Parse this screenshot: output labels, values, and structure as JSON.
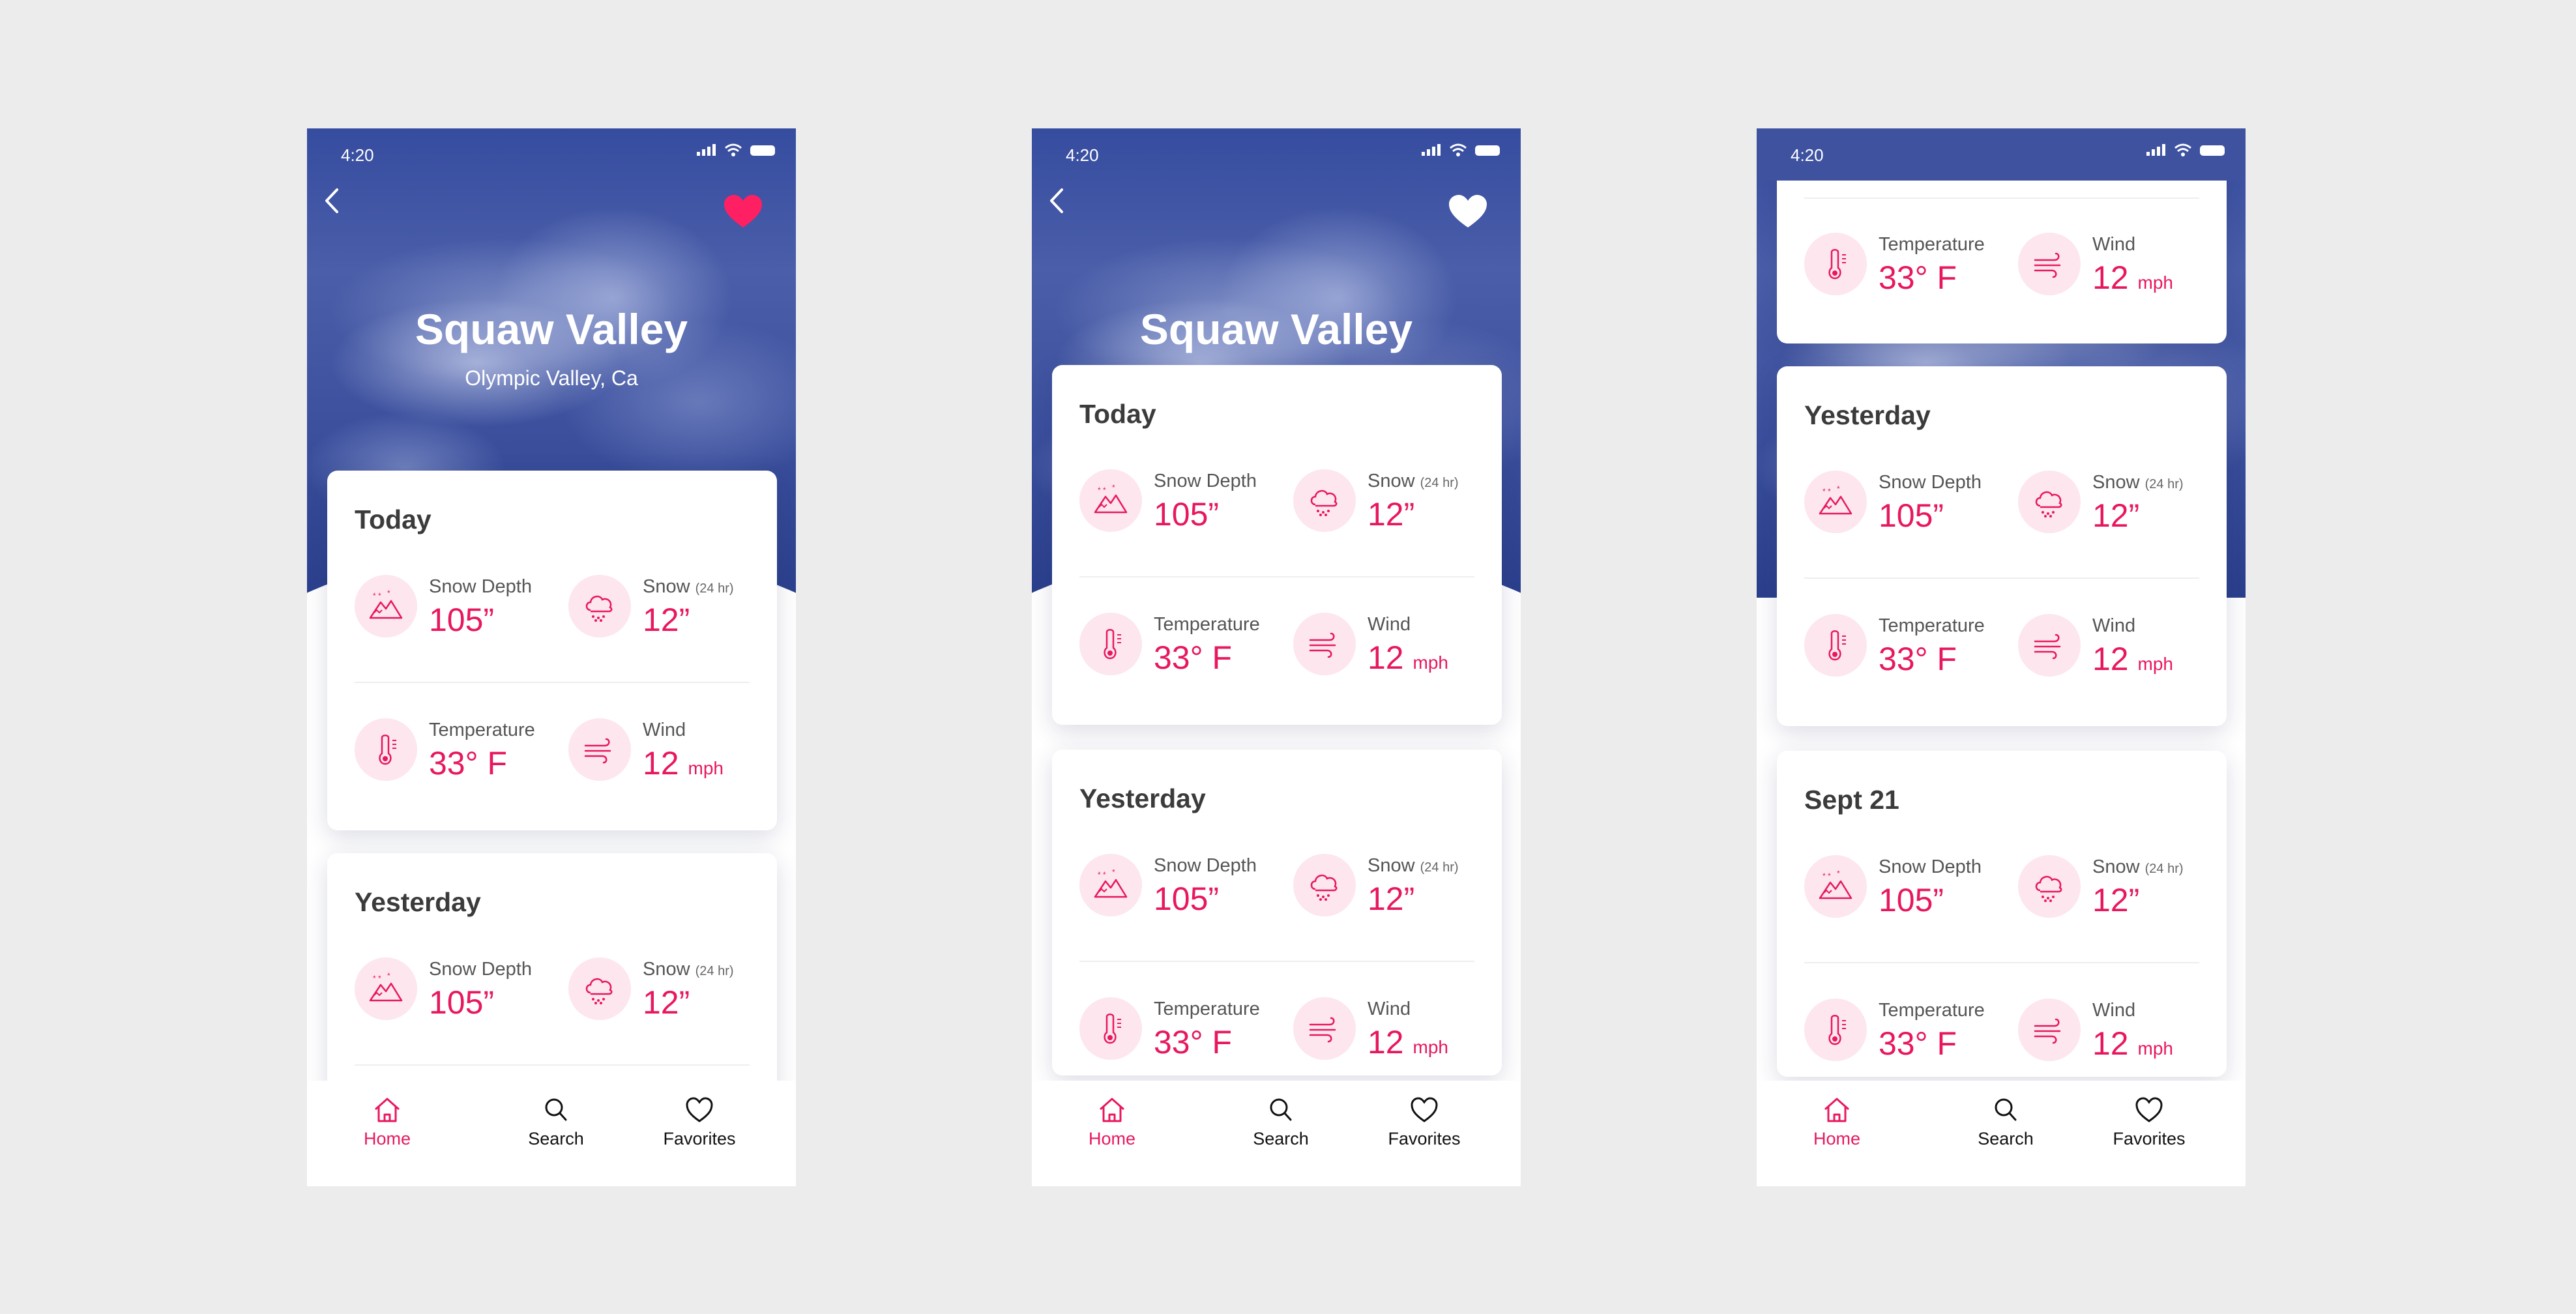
{
  "colors": {
    "accent": "#e8185e",
    "icon_bg": "#fde6ee",
    "hero": "#3a4f9e",
    "page_bg": "#ececec"
  },
  "status": {
    "time": "4:20"
  },
  "resort": {
    "name": "Squaw Valley",
    "location": "Olympic Valley, Ca"
  },
  "labels": {
    "snow_depth": "Snow Depth",
    "snow": "Snow",
    "snow_period": "(24 hr)",
    "temperature": "Temperature",
    "wind": "Wind"
  },
  "days": {
    "today": {
      "title": "Today",
      "snow_depth": "105”",
      "snow": "12”",
      "temperature": "33° F",
      "wind": "12",
      "wind_unit": "mph"
    },
    "yesterday": {
      "title": "Yesterday",
      "snow_depth": "105”",
      "snow": "12”",
      "temperature": "33° F",
      "wind": "12",
      "wind_unit": "mph"
    },
    "sept21": {
      "title": "Sept 21",
      "snow_depth": "105”",
      "snow": "12”",
      "temperature": "33° F",
      "wind": "12",
      "wind_unit": "mph"
    }
  },
  "nav": {
    "home": "Home",
    "search": "Search",
    "favorites": "Favorites"
  },
  "icons": {
    "back": "chevron-left-icon",
    "favorite": "heart-icon",
    "snow_depth": "mountain-snow-icon",
    "snow": "snow-cloud-icon",
    "temperature": "thermometer-icon",
    "wind": "wind-icon",
    "home": "home-icon",
    "search": "search-icon",
    "favorites": "heart-outline-icon"
  }
}
